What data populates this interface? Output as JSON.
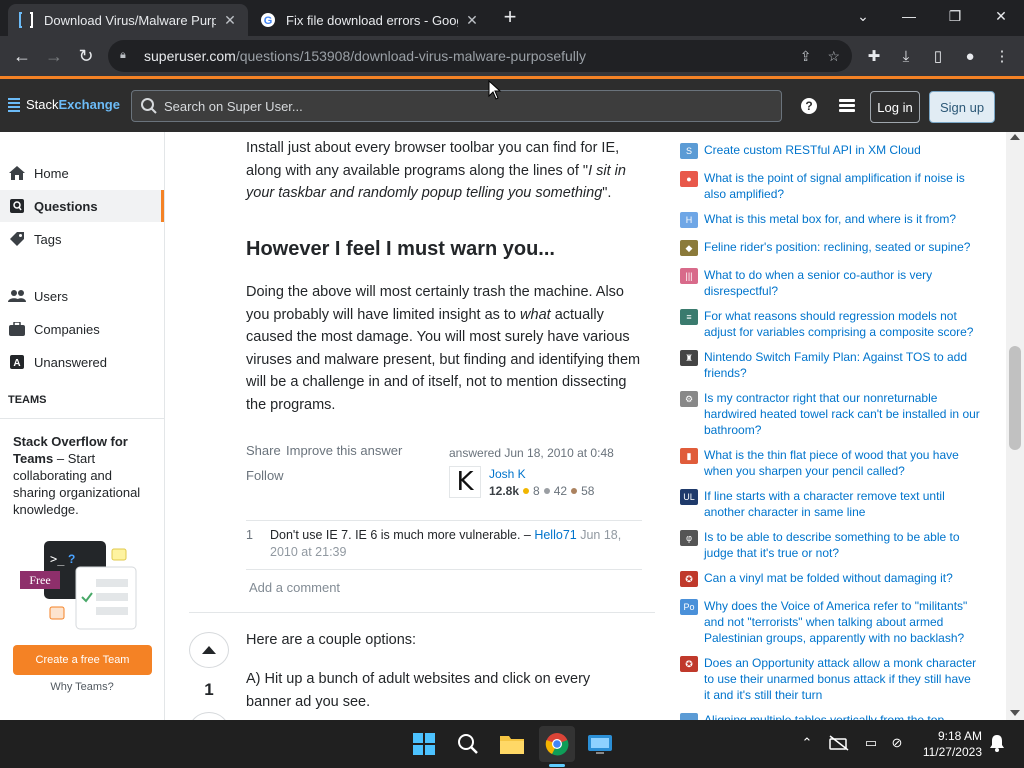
{
  "browser": {
    "tabs": [
      {
        "title": "Download Virus/Malware Purposefully",
        "active": true
      },
      {
        "title": "Fix file download errors - Google Chrome Help",
        "active": false
      }
    ],
    "address": {
      "host": "superuser.com",
      "path": "/questions/153908/download-virus-malware-purposefully"
    }
  },
  "site": {
    "logo_stack": "Stack",
    "logo_exchange": "Exchange",
    "search_placeholder": "Search on Super User...",
    "login": "Log in",
    "signup": "Sign up"
  },
  "leftnav": {
    "items": [
      "Home",
      "Questions",
      "Tags",
      "Users",
      "Companies",
      "Unanswered"
    ],
    "teams_heading": "TEAMS",
    "teams_title": "Stack Overflow for Teams",
    "teams_body": " – Start collaborating and sharing organizational knowledge.",
    "free_badge": "Free",
    "create_team": "Create a free Team",
    "why_teams": "Why Teams?"
  },
  "answer": {
    "p1_a": "Install just about every browser toolbar you can find for IE, along with any available programs along the lines of \"",
    "p1_em": "I sit in your taskbar and randomly popup telling you something",
    "p1_b": "\".",
    "heading": "However I feel I must warn you...",
    "p2_a": "Doing the above will most certainly trash the machine. Also you probably will have limited insight as to ",
    "p2_em": "what",
    "p2_b": " actually caused the most damage. You will most surely have various viruses and malware present, but finding and identifying them will be a challenge in and of itself, not to mention dissecting the programs.",
    "share": "Share",
    "improve": "Improve this answer",
    "follow": "Follow",
    "answered": "answered Jun 18, 2010 at 0:48",
    "user_initial": "K",
    "user_name": "Josh K",
    "rep": "12.8k",
    "gold": "8",
    "silver": "42",
    "bronze": "58",
    "comment_score": "1",
    "comment_text": "Don't use IE 7. IE 6 is much more vulnerable. – ",
    "comment_user": "Hello71",
    "comment_date": " Jun 18, 2010 at 21:39",
    "add_comment": "Add a comment"
  },
  "next_answer": {
    "votes": "1",
    "p1": "Here are a couple options:",
    "p2": "A) Hit up a bunch of adult websites and click on every banner ad you see."
  },
  "hot_questions": [
    {
      "icon": "S",
      "color": "#5b9bd5",
      "title": "Create custom RESTful API in XM Cloud"
    },
    {
      "icon": "●",
      "color": "#e8584a",
      "title": "What is the point of signal amplification if noise is also amplified?"
    },
    {
      "icon": "H",
      "color": "#6ea6e6",
      "title": "What is this metal box for, and where is it from?"
    },
    {
      "icon": "◆",
      "color": "#8b7a3a",
      "title": "Feline rider's position: reclining, seated or supine?"
    },
    {
      "icon": "|||",
      "color": "#d86a8a",
      "title": "What to do when a senior co-author is very disrespectful?"
    },
    {
      "icon": "≡",
      "color": "#3a7b6e",
      "title": "For what reasons should regression models not adjust for variables comprising a composite score?"
    },
    {
      "icon": "♜",
      "color": "#444444",
      "title": "Nintendo Switch Family Plan: Against TOS to add friends?"
    },
    {
      "icon": "⚙",
      "color": "#888888",
      "title": "Is my contractor right that our nonreturnable hardwired heated towel rack can't be installed in our bathroom?"
    },
    {
      "icon": "▮",
      "color": "#e05c3a",
      "title": "What is the thin flat piece of wood that you have when you sharpen your pencil called?"
    },
    {
      "icon": "UL",
      "color": "#1f3a6b",
      "title": "If line starts with a character remove text until another character in same line"
    },
    {
      "icon": "φ",
      "color": "#555555",
      "title": "Is to be able to describe something to be able to judge that it's true or not?"
    },
    {
      "icon": "✪",
      "color": "#c0392b",
      "title": "Can a vinyl mat be folded without damaging it?"
    },
    {
      "icon": "Po",
      "color": "#4a90d9",
      "title": "Why does the Voice of America refer to \"militants\" and not \"terrorists\" when talking about armed Palestinian groups, apparently with no backlash?"
    },
    {
      "icon": "✪",
      "color": "#c0392b",
      "title": "Does an Opportunity attack allow a monk character to use their unarmed bonus attack if they still have it and it's still their turn"
    },
    {
      "icon": "▭",
      "color": "#5b9bd5",
      "title": "Aligning multiple tables vertically from the top"
    }
  ],
  "taskbar": {
    "time": "9:18 AM",
    "date": "11/27/2023"
  }
}
